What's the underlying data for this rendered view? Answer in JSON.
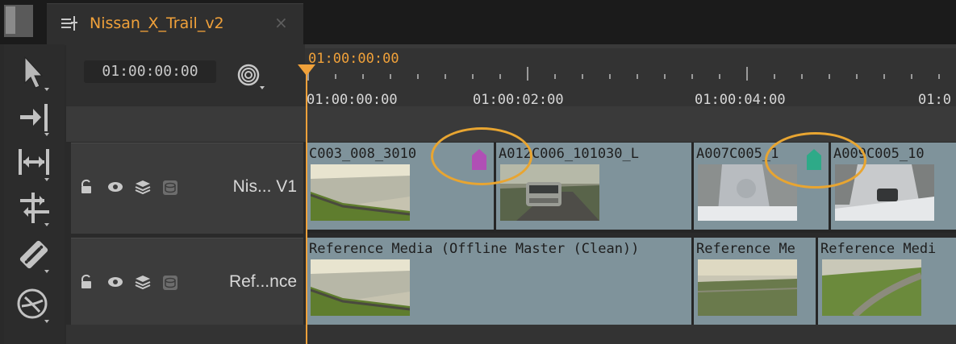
{
  "tab": {
    "title": "Nissan_X_Trail_v2",
    "close": "×",
    "icon": "sequence-icon"
  },
  "toolbar": {
    "icons": [
      "pointer-tool-icon",
      "ripple-tool-icon",
      "slip-clip-icon",
      "multi-track-select-icon",
      "razor-tool-icon",
      "audio-scrub-icon"
    ]
  },
  "header": {
    "timecode": "01:00:00:00",
    "snap_icon": "snap-icon"
  },
  "ruler": {
    "current_timecode": "01:00:00:00",
    "labels": [
      "01:00:00:00",
      "01:00:02:00",
      "01:00:04:00",
      "01:0"
    ]
  },
  "tracks": [
    {
      "name": "Nis... V1",
      "icons": [
        "lock-icon",
        "eye-icon",
        "layers-icon",
        "disk-icon"
      ]
    },
    {
      "name": "Ref...nce",
      "icons": [
        "lock-icon",
        "eye-icon",
        "layers-icon",
        "disk-icon"
      ]
    }
  ],
  "clips_v1": [
    {
      "name": "C003_008_3010",
      "tag_color": "#b04fb5"
    },
    {
      "name": "A012C006_101030_L"
    },
    {
      "name": "A007C005_1",
      "tag_color": "#2eaa88"
    },
    {
      "name": "A009C005_10"
    }
  ],
  "clips_ref": [
    {
      "name": "Reference Media (Offline Master (Clean))"
    },
    {
      "name": "Reference Me"
    },
    {
      "name": "Reference Medi"
    }
  ],
  "colors": {
    "accent": "#f0a13a",
    "highlight_ring": "#e8a531",
    "clip": "#7f939b"
  }
}
